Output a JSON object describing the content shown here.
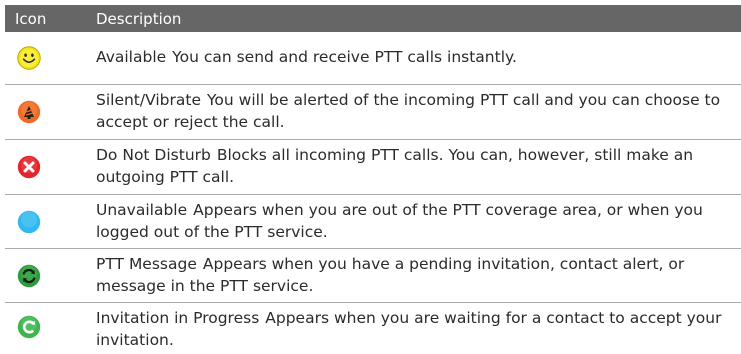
{
  "header": {
    "icon": "Icon",
    "description": "Description"
  },
  "rows": [
    {
      "icon": "smiley-icon",
      "color": "#f4e21c",
      "term": "Available",
      "text": "You can send and receive PTT calls instantly."
    },
    {
      "icon": "silent-vibrate-icon",
      "color": "#f06a23",
      "term": "Silent/Vibrate",
      "text": "You will be alerted of the incoming PTT call and you can choose to accept or reject the call."
    },
    {
      "icon": "do-not-disturb-icon",
      "color": "#e0262c",
      "term": "Do Not Disturb",
      "text": "Blocks all incoming PTT calls. You can, however, still make an outgoing PTT call."
    },
    {
      "icon": "unavailable-icon",
      "color": "#31b8ef",
      "term": "Unavailable",
      "text": "Appears when you are out of the PTT coverage area, or when you logged out of the PTT service."
    },
    {
      "icon": "ptt-message-icon",
      "color": "#2c9d3a",
      "term": "PTT Message",
      "text": "Appears when you have a pending invitation, contact alert, or message in the PTT service."
    },
    {
      "icon": "invitation-in-progress-icon",
      "color": "#3fb34f",
      "term": "Invitation in Progress",
      "text": "Appears when you are waiting for a contact to accept your invitation."
    }
  ]
}
